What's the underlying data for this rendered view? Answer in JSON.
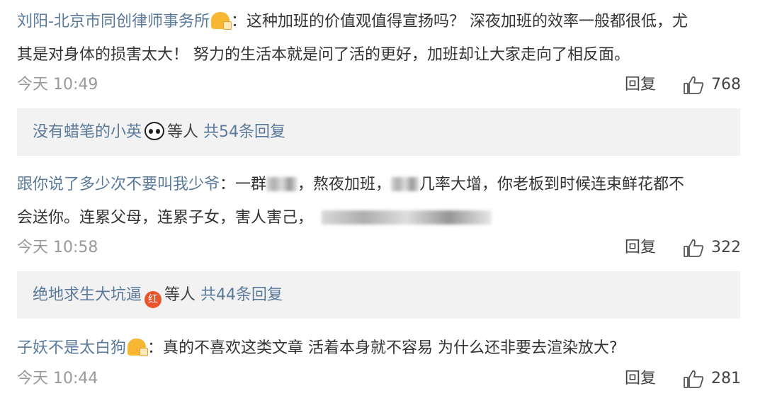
{
  "comments": [
    {
      "author": "刘阳-北京市同创律师事务所",
      "text_line1": "：这种加班的价值观值得宣扬吗？ 深夜加班的效率一般都很低，尤",
      "text_line2": "其是对身体的损害太大！ 努力的生活本就是问了活的更好，加班却让大家走向了相反面。",
      "time": "今天 10:49",
      "reply_label": "回复",
      "likes": "768",
      "replies": {
        "names": "没有蜡笔的小英",
        "suffix": "等人",
        "count_text": "共54条回复"
      }
    },
    {
      "author": "跟你说了多少次不要叫我少爷",
      "text_line1_a": "：一群",
      "text_line1_b": "，熬夜加班，",
      "text_line1_c": "几率大增，你老板到时候连束鲜花都不",
      "text_line2": "会送你。连累父母，连累子女，害人害己，",
      "time": "今天 10:58",
      "reply_label": "回复",
      "likes": "322",
      "replies": {
        "names": "绝地求生大坑逼",
        "badge_text": "红",
        "suffix": "等人",
        "count_text": "共44条回复"
      }
    },
    {
      "author": "子妖不是太白狗",
      "text_line1": "：真的不喜欢这类文章 活着本身就不容易 为什么还非要去渲染放大?",
      "time": "今天 10:44",
      "reply_label": "回复",
      "likes": "281"
    }
  ],
  "icons": {
    "like": "thumbs-up-icon",
    "vip_badge": "crown-face-badge-icon",
    "panda": "panda-icon",
    "hong": "red-badge-icon"
  },
  "colors": {
    "author": "#5b7a9b",
    "meta": "#999999",
    "reply_bg": "#f2f2f2",
    "badge": "#f7b733",
    "hong": "#e8542b"
  }
}
